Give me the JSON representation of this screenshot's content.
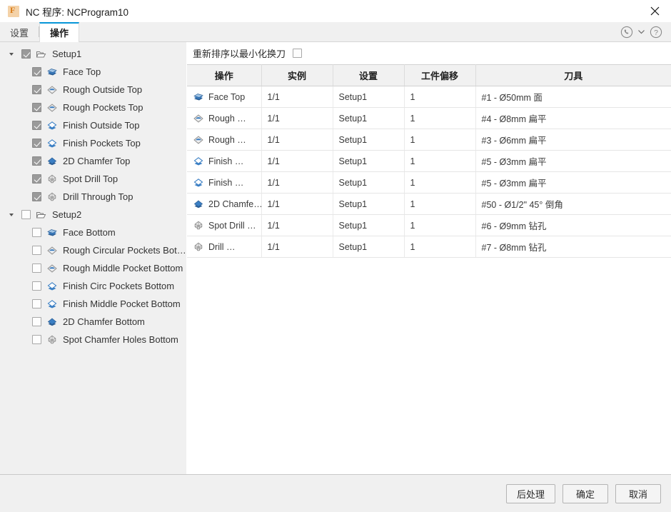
{
  "window": {
    "title": "NC 程序: NCProgram10",
    "app_icon": "fusion-f-icon",
    "close_icon": "close-icon"
  },
  "tabs": [
    {
      "label": "设置",
      "active": false
    },
    {
      "label": "操作",
      "active": true
    }
  ],
  "tabbar_actions": [
    {
      "name": "support-phone-icon",
      "label": ""
    },
    {
      "name": "chevron-down-icon",
      "label": ""
    },
    {
      "name": "help-icon",
      "label": ""
    }
  ],
  "tree": [
    {
      "label": "Setup1",
      "icon": "folder-icon",
      "checked": true,
      "level": 0,
      "expanded": true
    },
    {
      "label": "Face Top",
      "icon": "face-op-icon",
      "checked": true,
      "level": 1
    },
    {
      "label": "Rough Outside Top",
      "icon": "adaptive-rough-icon",
      "checked": true,
      "level": 1
    },
    {
      "label": "Rough Pockets Top",
      "icon": "adaptive-rough-icon",
      "checked": true,
      "level": 1
    },
    {
      "label": "Finish Outside Top",
      "icon": "contour-finish-icon",
      "checked": true,
      "level": 1
    },
    {
      "label": "Finish Pockets Top",
      "icon": "contour-finish-icon",
      "checked": true,
      "level": 1
    },
    {
      "label": "2D Chamfer Top",
      "icon": "chamfer-icon",
      "checked": true,
      "level": 1
    },
    {
      "label": "Spot Drill Top",
      "icon": "drill-icon",
      "checked": true,
      "level": 1
    },
    {
      "label": "Drill Through Top",
      "icon": "drill-icon",
      "checked": true,
      "level": 1
    },
    {
      "label": "Setup2",
      "icon": "folder-icon",
      "checked": false,
      "level": 0,
      "expanded": true
    },
    {
      "label": "Face Bottom",
      "icon": "face-op-icon",
      "checked": false,
      "level": 1
    },
    {
      "label": "Rough Circular Pockets Bott…",
      "icon": "adaptive-rough-icon",
      "checked": false,
      "level": 1
    },
    {
      "label": "Rough Middle Pocket Bottom",
      "icon": "adaptive-rough-icon",
      "checked": false,
      "level": 1
    },
    {
      "label": "Finish Circ Pockets Bottom",
      "icon": "contour-finish-icon",
      "checked": false,
      "level": 1
    },
    {
      "label": "Finish Middle Pocket Bottom",
      "icon": "contour-finish-icon",
      "checked": false,
      "level": 1
    },
    {
      "label": "2D Chamfer Bottom",
      "icon": "chamfer-icon",
      "checked": false,
      "level": 1
    },
    {
      "label": "Spot Chamfer Holes Bottom",
      "icon": "drill-icon",
      "checked": false,
      "level": 1
    }
  ],
  "panel": {
    "reorder_label": "重新排序以最小化换刀",
    "reorder_checked": false,
    "columns": [
      "操作",
      "实例",
      "设置",
      "工件偏移",
      "刀具"
    ],
    "rows": [
      {
        "icon": "face-op-icon",
        "operation": "Face Top",
        "instances": "1/1",
        "setup": "Setup1",
        "wcs": "1",
        "tool": "#1 - Ø50mm 面"
      },
      {
        "icon": "adaptive-rough-icon",
        "operation": "Rough …",
        "instances": "1/1",
        "setup": "Setup1",
        "wcs": "1",
        "tool": "#4 - Ø8mm 扁平"
      },
      {
        "icon": "adaptive-rough-icon",
        "operation": "Rough …",
        "instances": "1/1",
        "setup": "Setup1",
        "wcs": "1",
        "tool": "#3 - Ø6mm 扁平"
      },
      {
        "icon": "contour-finish-icon",
        "operation": "Finish …",
        "instances": "1/1",
        "setup": "Setup1",
        "wcs": "1",
        "tool": "#5 - Ø3mm 扁平"
      },
      {
        "icon": "contour-finish-icon",
        "operation": "Finish …",
        "instances": "1/1",
        "setup": "Setup1",
        "wcs": "1",
        "tool": "#5 - Ø3mm 扁平"
      },
      {
        "icon": "chamfer-icon",
        "operation": "2D Chamfe…",
        "instances": "1/1",
        "setup": "Setup1",
        "wcs": "1",
        "tool": "#50 - Ø1/2\" 45° 倒角"
      },
      {
        "icon": "drill-icon",
        "operation": "Spot Drill …",
        "instances": "1/1",
        "setup": "Setup1",
        "wcs": "1",
        "tool": "#6 - Ø9mm 钻孔"
      },
      {
        "icon": "drill-icon",
        "operation": "Drill …",
        "instances": "1/1",
        "setup": "Setup1",
        "wcs": "1",
        "tool": "#7 - Ø8mm 钻孔"
      }
    ]
  },
  "footer": {
    "buttons": [
      {
        "label": "后处理",
        "name": "post-process-button"
      },
      {
        "label": "确定",
        "name": "ok-button"
      },
      {
        "label": "取消",
        "name": "cancel-button"
      }
    ]
  },
  "colors": {
    "accent": "#0696d7",
    "sidebar_bg": "#f0f0f0",
    "panel_bg": "#ffffff",
    "icon_blue": "#3b7fc4"
  }
}
